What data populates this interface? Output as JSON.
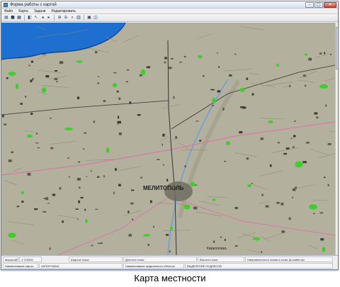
{
  "window": {
    "title": "Форма работы с картой",
    "buttons": {
      "minimize": "–",
      "maximize": "□",
      "close": "✕"
    }
  },
  "menu": {
    "items": [
      "Файл",
      "Карта",
      "Задачи",
      "Редактировать"
    ]
  },
  "toolbar": {
    "icons": [
      "open-icon",
      "save-icon",
      "print-icon",
      "layers-icon",
      "pointer-icon",
      "zoom-in-icon",
      "zoom-out-icon",
      "search-icon",
      "grid-icon",
      "select-icon",
      "info-icon"
    ]
  },
  "map": {
    "labels": {
      "city": "МЕЛИТОПОЛЬ",
      "kirillovka": "Кирилловка"
    },
    "colors": {
      "terrain": "#b3b09e",
      "sea": "#1f6fd1",
      "forest": "#3ecf2a",
      "road": "#d67aa4"
    }
  },
  "status": {
    "scale_label": "Масштаб:",
    "scale_value": "1:710000",
    "lat_label": "Широта точки:",
    "lon_label": "Долгота точки:",
    "height_label": "Высота точки:",
    "pos_hint": "Направленность линии в точке (Ш.кабел.м)",
    "map_name_label": "Наименование карты:",
    "map_name_value": "ЗАПОРОЖЬЕ",
    "object_label": "Наименование выделенного объекта:",
    "object_value": "ВЫДЕЛЕНИЕ ПОДЛЕСОВ"
  },
  "caption": "Карта местности"
}
